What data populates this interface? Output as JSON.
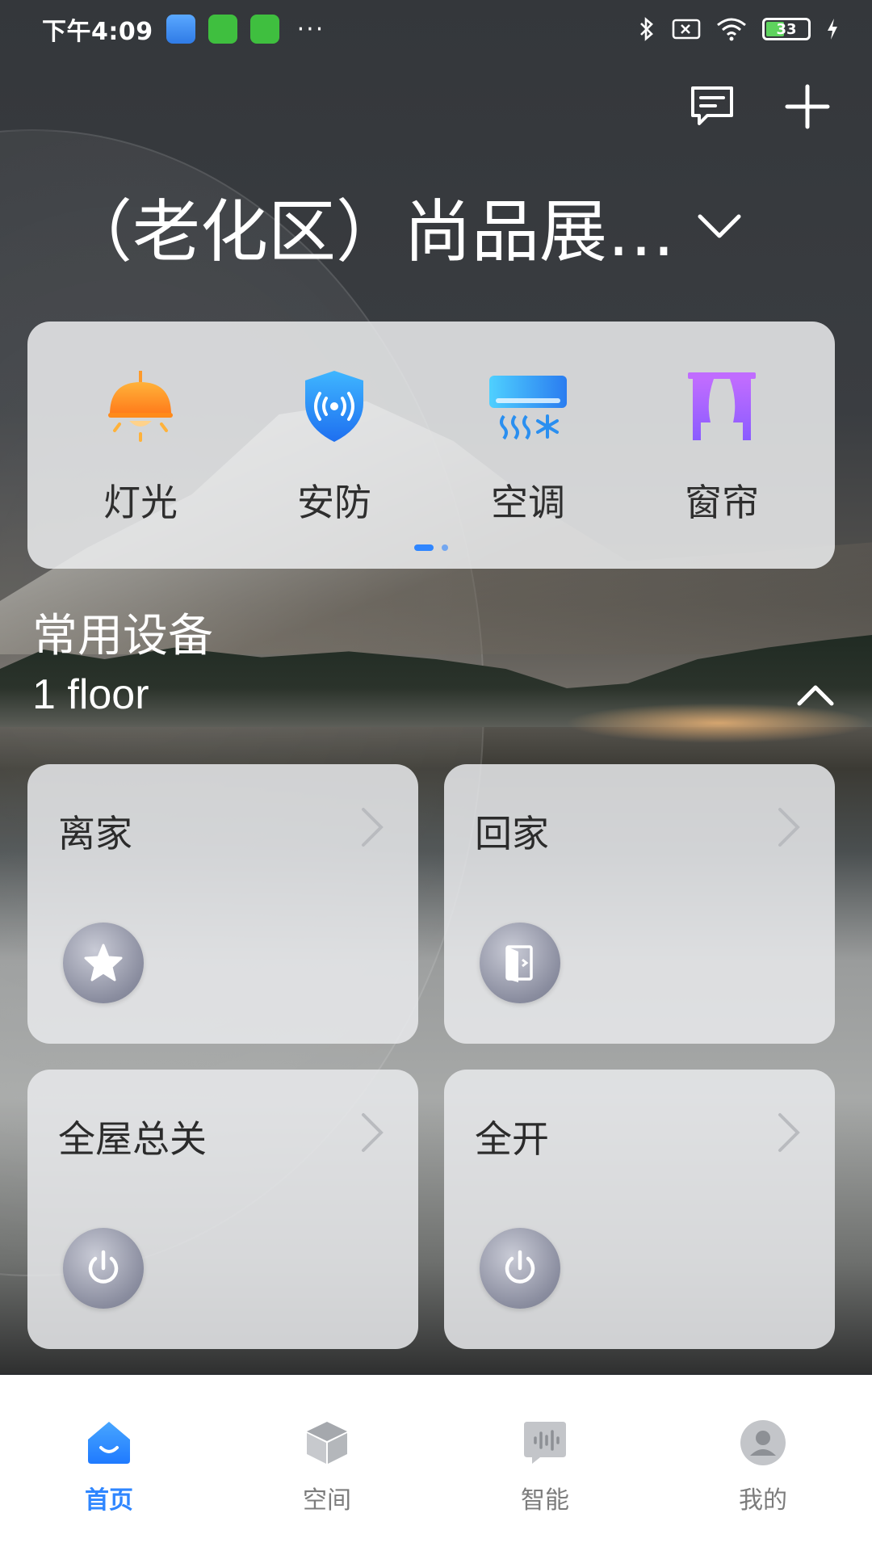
{
  "status_bar": {
    "time": "下午4:09",
    "more": "···",
    "battery": "33"
  },
  "header": {
    "home_name": "（老化区）尚品展…",
    "message_icon": "message-icon",
    "add_icon": "plus-icon",
    "dropdown_icon": "chevron-down-icon"
  },
  "categories": [
    {
      "label": "灯光",
      "icon": "lamp-icon"
    },
    {
      "label": "安防",
      "icon": "shield-icon"
    },
    {
      "label": "空调",
      "icon": "air-conditioner-icon"
    },
    {
      "label": "窗帘",
      "icon": "curtain-icon"
    }
  ],
  "section": {
    "title": "常用设备",
    "floor": "1 floor"
  },
  "scenes": [
    {
      "label": "离家",
      "icon": "star-icon"
    },
    {
      "label": "回家",
      "icon": "door-icon"
    },
    {
      "label": "全屋总关",
      "icon": "power-icon"
    },
    {
      "label": "全开",
      "icon": "power-icon"
    }
  ],
  "bottom_nav": [
    {
      "label": "首页",
      "active": true,
      "icon": "home-icon"
    },
    {
      "label": "空间",
      "active": false,
      "icon": "cube-icon"
    },
    {
      "label": "智能",
      "active": false,
      "icon": "smart-icon"
    },
    {
      "label": "我的",
      "active": false,
      "icon": "profile-icon"
    }
  ],
  "colors": {
    "accent": "#2f86ff",
    "card_bg": "#ebeced",
    "nav_inactive": "#7c7c7c"
  }
}
